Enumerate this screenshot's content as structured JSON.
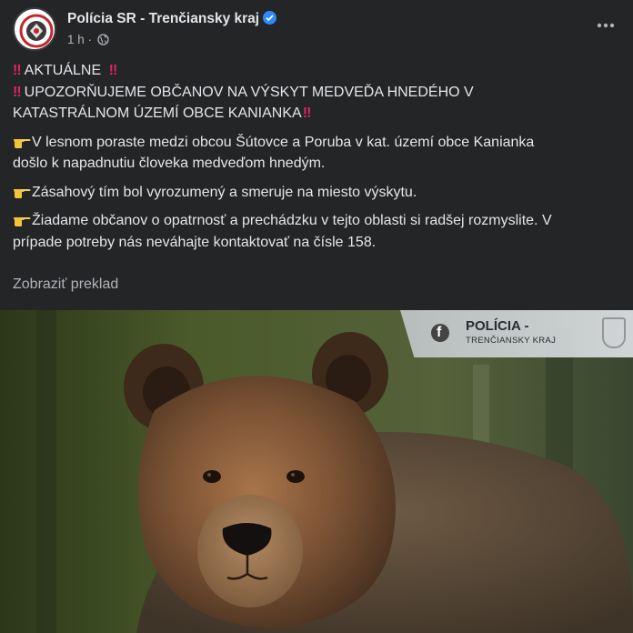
{
  "post": {
    "author": "Polícia SR - Trenčiansky kraj",
    "time": "1 h",
    "separator": "·",
    "verified": true,
    "lines": {
      "l1": "AKTUÁLNE",
      "l2": "UPOZORŇUJEME OBČANOV NA VÝSKYT MEDVEĎA HNEDÉHO V",
      "l3": "KATASTRÁLNOM ÚZEMÍ OBCE KANIANKA",
      "p1a": "V lesnom poraste medzi obcou Šútovce a Poruba v kat. území obce Kanianka",
      "p1b": "došlo k napadnutiu človeka medveďom hnedým.",
      "p2": "Zásahový tím bol vyrozumený a smeruje na miesto výskytu.",
      "p3a": "Žiadame občanov o opatrnosť a prechádzku v tejto oblasti si radšej rozmyslite. V",
      "p3b": "prípade potreby nás neváhajte kontaktovať na čísle 158."
    },
    "translate_link": "Zobraziť preklad",
    "bang": "‼",
    "watermark": {
      "title": "POLÍCIA -",
      "subtitle": "TRENČIANSKY KRAJ",
      "fb_glyph": "f"
    }
  },
  "colors": {
    "background": "#242526",
    "text": "#e4e6eb",
    "secondary": "#b0b3b8",
    "verified": "#2d88ff",
    "emoji_red": "#e0245e"
  },
  "icons": [
    "verified-badge-icon",
    "globe-icon",
    "more-options-icon",
    "exclamation-emoji",
    "pointing-hand-emoji",
    "facebook-icon"
  ]
}
